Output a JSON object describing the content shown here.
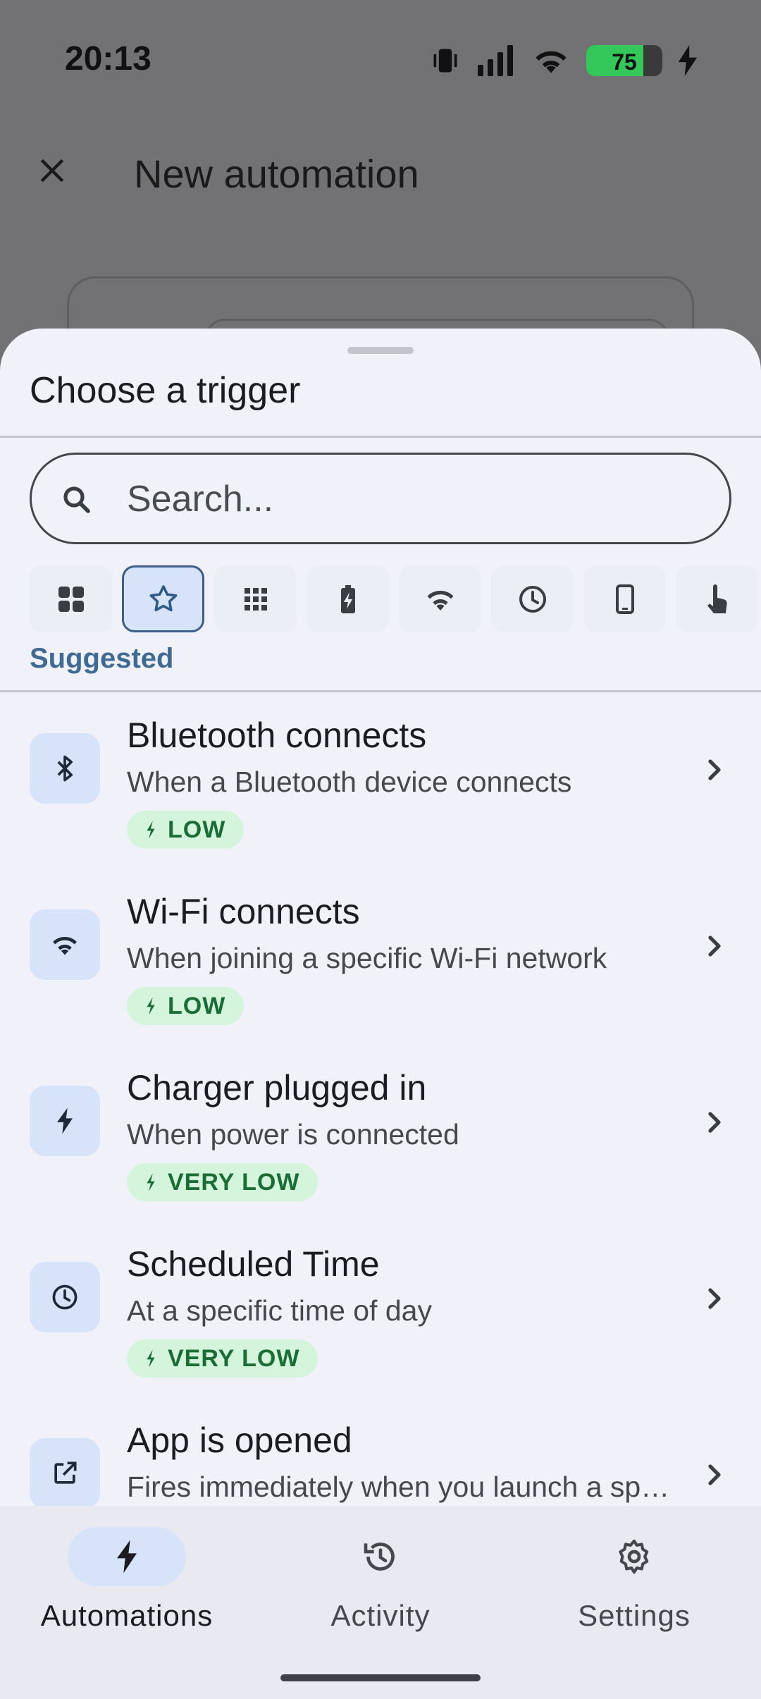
{
  "status_bar": {
    "time": "20:13",
    "battery_percent": "75",
    "battery_level": 0.75
  },
  "background": {
    "title": "New automation"
  },
  "sheet": {
    "title": "Choose a trigger",
    "search": {
      "placeholder": "Search...",
      "value": ""
    },
    "category_chips": [
      {
        "icon": "grid-icon",
        "selected": false
      },
      {
        "icon": "star-icon",
        "selected": true
      },
      {
        "icon": "apps-icon",
        "selected": false
      },
      {
        "icon": "battery-charging-icon",
        "selected": false
      },
      {
        "icon": "wifi-icon",
        "selected": false
      },
      {
        "icon": "clock-icon",
        "selected": false
      },
      {
        "icon": "phone-icon",
        "selected": false
      },
      {
        "icon": "touch-icon",
        "selected": false
      }
    ],
    "category_label": "Suggested",
    "items": [
      {
        "icon": "bluetooth-icon",
        "title": "Bluetooth connects",
        "subtitle": "When a Bluetooth device connects",
        "badge": "LOW"
      },
      {
        "icon": "wifi-icon",
        "title": "Wi-Fi connects",
        "subtitle": "When joining a specific Wi-Fi network",
        "badge": "LOW"
      },
      {
        "icon": "bolt-icon",
        "title": "Charger plugged in",
        "subtitle": "When power is connected",
        "badge": "VERY LOW"
      },
      {
        "icon": "clock-icon",
        "title": "Scheduled Time",
        "subtitle": "At a specific time of day",
        "badge": "VERY LOW"
      },
      {
        "icon": "open-app-icon",
        "title": "App is opened",
        "subtitle": "Fires immediately when you launch a specific app",
        "badge": ""
      }
    ]
  },
  "bottom_nav": {
    "items": [
      {
        "label": "Automations",
        "icon": "bolt-icon",
        "active": true
      },
      {
        "label": "Activity",
        "icon": "history-icon",
        "active": false
      },
      {
        "label": "Settings",
        "icon": "gear-icon",
        "active": false
      }
    ]
  },
  "colors": {
    "accent": "#3e6a96",
    "chip_selected": "#d6e3f8",
    "badge_bg": "#d4f5dc",
    "badge_text": "#1b6d36",
    "scrim": "#727275"
  }
}
